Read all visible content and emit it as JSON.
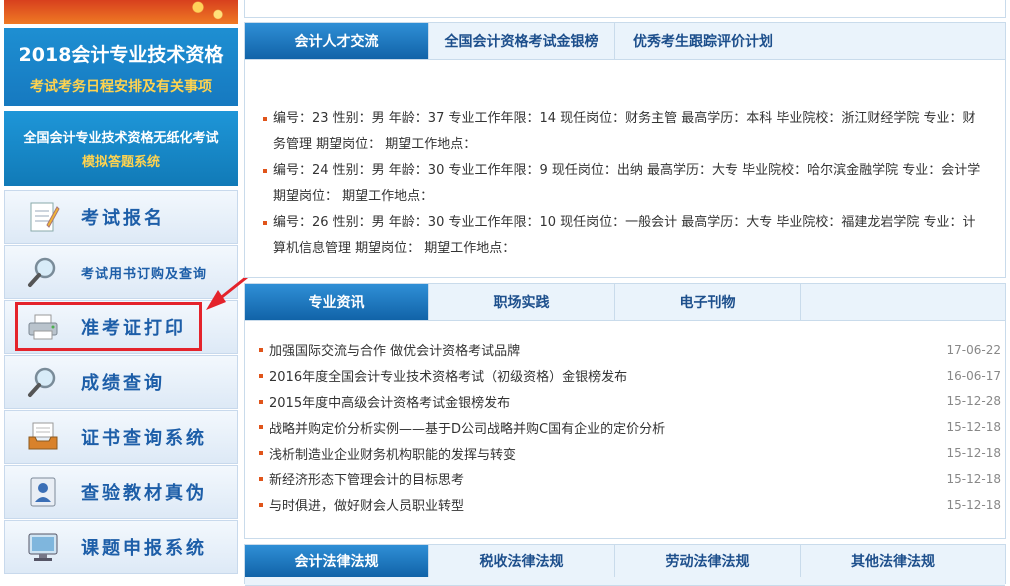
{
  "sidebar": {
    "banner1": {
      "line1": "2018会计专业技术资格",
      "line2": "考试考务日程安排及有关事项"
    },
    "banner2": {
      "line1": "全国会计专业技术资格无纸化考试",
      "line2": "模拟答题系统"
    },
    "items": [
      {
        "label": "考试报名",
        "icon": "notepad-icon"
      },
      {
        "label": "考试用书订购及查询",
        "icon": "magnifier-icon"
      },
      {
        "label": "准考证打印",
        "icon": "printer-icon"
      },
      {
        "label": "成绩查询",
        "icon": "magnifier-icon"
      },
      {
        "label": "证书查询系统",
        "icon": "inbox-tray-icon"
      },
      {
        "label": "查验教材真伪",
        "icon": "id-card-icon"
      },
      {
        "label": "课题申报系统",
        "icon": "monitor-icon"
      }
    ]
  },
  "talent_panel": {
    "tabs": [
      "会计人才交流",
      "全国会计资格考试金银榜",
      "优秀考生跟踪评价计划"
    ],
    "profiles": [
      "编号：23 性别：男 年龄：37 专业工作年限：14 现任岗位：财务主管 最高学历：本科 毕业院校：浙江财经学院 专业：财务管理 期望岗位： 期望工作地点：",
      "编号：24 性别：男 年龄：30 专业工作年限：9 现任岗位：出纳 最高学历：大专 毕业院校：哈尔滨金融学院 专业：会计学 期望岗位： 期望工作地点：",
      "编号：26 性别：男 年龄：30 专业工作年限：10 现任岗位：一般会计 最高学历：大专 毕业院校：福建龙岩学院 专业：计算机信息管理 期望岗位： 期望工作地点："
    ]
  },
  "news_panel": {
    "tabs": [
      "专业资讯",
      "职场实践",
      "电子刊物"
    ],
    "items": [
      {
        "title": "加强国际交流与合作 做优会计资格考试品牌",
        "date": "17-06-22"
      },
      {
        "title": "2016年度全国会计专业技术资格考试（初级资格）金银榜发布",
        "date": "16-06-17"
      },
      {
        "title": "2015年度中高级会计资格考试金银榜发布",
        "date": "15-12-28"
      },
      {
        "title": "战略并购定价分析实例——基于D公司战略并购C国有企业的定价分析",
        "date": "15-12-18"
      },
      {
        "title": "浅析制造业企业财务机构职能的发挥与转变",
        "date": "15-12-18"
      },
      {
        "title": "新经济形态下管理会计的目标思考",
        "date": "15-12-18"
      },
      {
        "title": "与时俱进，做好财会人员职业转型",
        "date": "15-12-18"
      }
    ]
  },
  "law_panel": {
    "tabs": [
      "会计法律法规",
      "税收法律法规",
      "劳动法律法规",
      "其他法律法规"
    ]
  },
  "colors": {
    "accent": "#1163a8",
    "highlight": "#e4232b",
    "bullet": "#e0541a"
  }
}
